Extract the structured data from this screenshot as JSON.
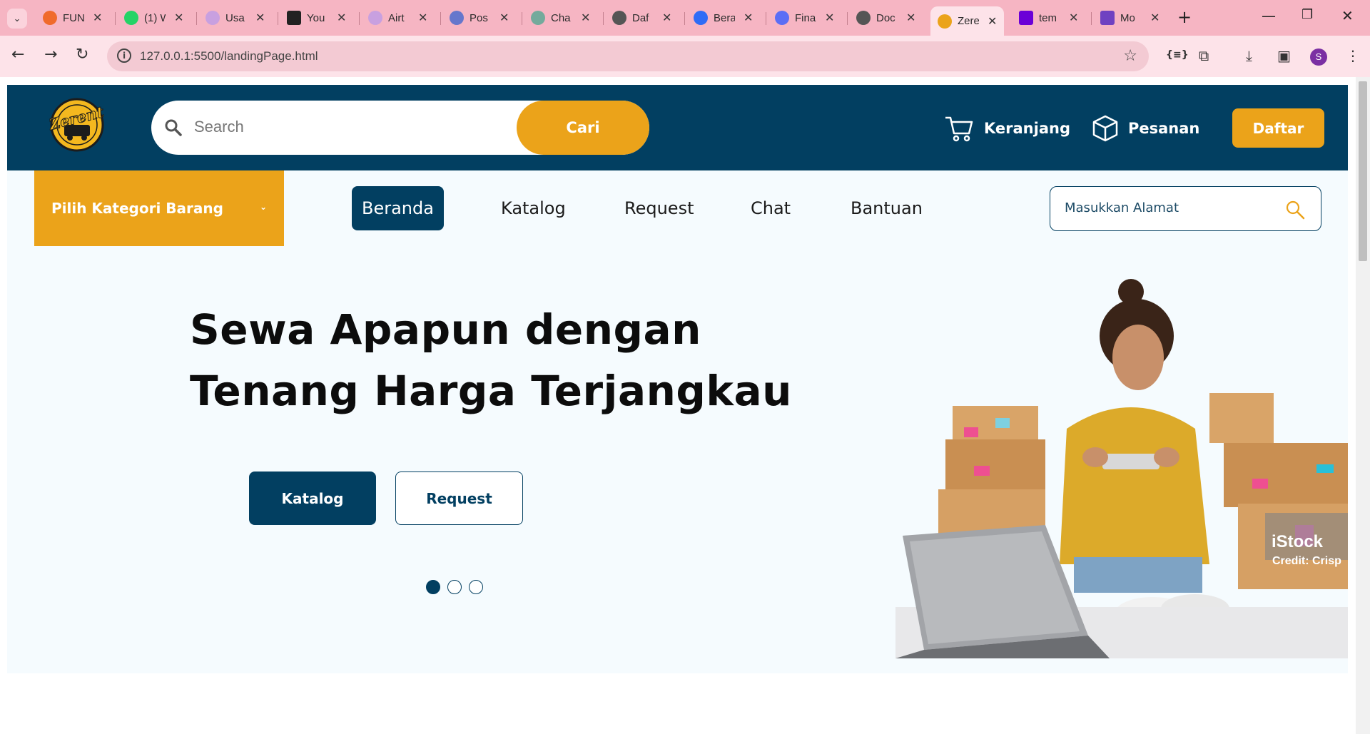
{
  "browser": {
    "tabs": [
      {
        "title": "FUN",
        "color": "#f06a2c"
      },
      {
        "title": "(1) W",
        "color": "#25d366"
      },
      {
        "title": "Usa",
        "color": "#c8a0e0"
      },
      {
        "title": "You",
        "color": "#222222"
      },
      {
        "title": "Airt",
        "color": "#c8a0e0"
      },
      {
        "title": "Pos",
        "color": "#6677cc"
      },
      {
        "title": "Cha",
        "color": "#74aa9c"
      },
      {
        "title": "Daf",
        "color": "#555555"
      },
      {
        "title": "Bera",
        "color": "#2f6cf6"
      },
      {
        "title": "Fina",
        "color": "#5b6ef5"
      },
      {
        "title": "Doc",
        "color": "#555555"
      },
      {
        "title": "Zere",
        "color": "#eba31a",
        "active": true
      },
      {
        "title": "tem",
        "color": "#6b00d7"
      },
      {
        "title": "Mo",
        "color": "#6f42c1"
      }
    ],
    "url": "127.0.0.1:5500/landingPage.html",
    "profile_initial": "S"
  },
  "header": {
    "logo_text": "Zerent",
    "search_placeholder": "Search",
    "search_button": "Cari",
    "cart_label": "Keranjang",
    "orders_label": "Pesanan",
    "register_button": "Daftar"
  },
  "subnav": {
    "category_label": "Pilih Kategori Barang",
    "items": [
      "Beranda",
      "Katalog",
      "Request",
      "Chat",
      "Bantuan"
    ],
    "active": "Beranda",
    "address_placeholder": "Masukkan Alamat"
  },
  "hero": {
    "headline_line1": "Sewa Apapun dengan",
    "headline_line2": "Tenang Harga Terjangkau",
    "button_katalog": "Katalog",
    "button_request": "Request",
    "slide_count": 3,
    "active_slide": 1,
    "image_watermark": "iStock",
    "image_credit": "Credit: Crisp"
  },
  "colors": {
    "navy": "#023f61",
    "accent": "#eba31a",
    "hero_bg": "#f5fbfe"
  }
}
